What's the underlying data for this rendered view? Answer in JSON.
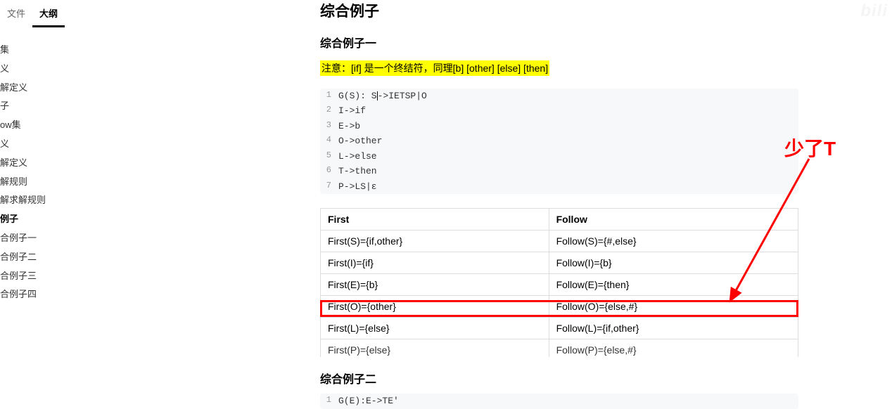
{
  "sidebar": {
    "tabs": {
      "file": "文件",
      "outline": "大纲"
    },
    "items": [
      {
        "label": "集",
        "bold": false
      },
      {
        "label": "义",
        "bold": false
      },
      {
        "label": "解定义",
        "bold": false
      },
      {
        "label": "子",
        "bold": false
      },
      {
        "label": "ow集",
        "bold": false
      },
      {
        "label": "义",
        "bold": false
      },
      {
        "label": "解定义",
        "bold": false
      },
      {
        "label": "解规则",
        "bold": false
      },
      {
        "label": "解求解规则",
        "bold": false
      },
      {
        "label": "例子",
        "bold": true
      },
      {
        "label": "合例子一",
        "bold": false
      },
      {
        "label": "合例子二",
        "bold": false
      },
      {
        "label": "合例子三",
        "bold": false
      },
      {
        "label": "合例子四",
        "bold": false
      }
    ]
  },
  "main": {
    "title": "综合例子",
    "sub1": "综合例子一",
    "note": "注意：[if] 是一个终结符，同理[b] [other] [else] [then]",
    "code": {
      "lang": "bash",
      "lines": [
        "G(S): S->IETSP|O",
        "I->if",
        "E->b",
        "O->other",
        "L->else",
        "T->then",
        "P->LS|ε"
      ]
    },
    "table": {
      "headers": {
        "first": "First",
        "follow": "Follow"
      },
      "rows": [
        {
          "first": "First(S)={if,other}",
          "follow": "Follow(S)={#,else}"
        },
        {
          "first": "First(I)={if}",
          "follow": "Follow(I)={b}"
        },
        {
          "first": "First(E)={b}",
          "follow": "Follow(E)={then}"
        },
        {
          "first": "First(O)={other}",
          "follow": "Follow(O)={else,#}"
        },
        {
          "first": "First(L)={else}",
          "follow": "Follow(L)={if,other}"
        },
        {
          "first": "First(P)={else}",
          "follow": "Follow(P)={else,#}"
        }
      ]
    },
    "sub2": "综合例子二",
    "code2_line": "G(E):E->TE'"
  },
  "annotation": {
    "text": "少了T"
  },
  "watermark": "bili"
}
